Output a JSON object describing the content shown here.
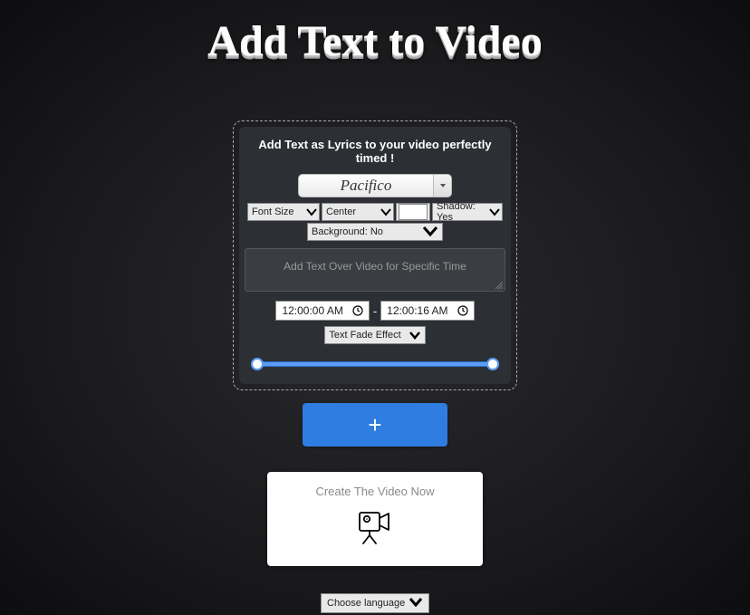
{
  "title": "Add Text to Video",
  "panel": {
    "header": "Add Text as Lyrics to your video perfectly timed !",
    "font_name": "Pacifico",
    "font_size_label": "Font Size",
    "align_label": "Center",
    "shadow_label": "Shadow: Yes",
    "background_label": "Background: No",
    "textarea_placeholder": "Add Text Over Video for Specific Time",
    "time_start": "12:00:00 AM",
    "time_end": "12:00:16 AM",
    "effect_label": "Text Fade Effect"
  },
  "add_button": "+",
  "create_card": {
    "title": "Create The Video Now"
  },
  "language_label": "Choose language"
}
